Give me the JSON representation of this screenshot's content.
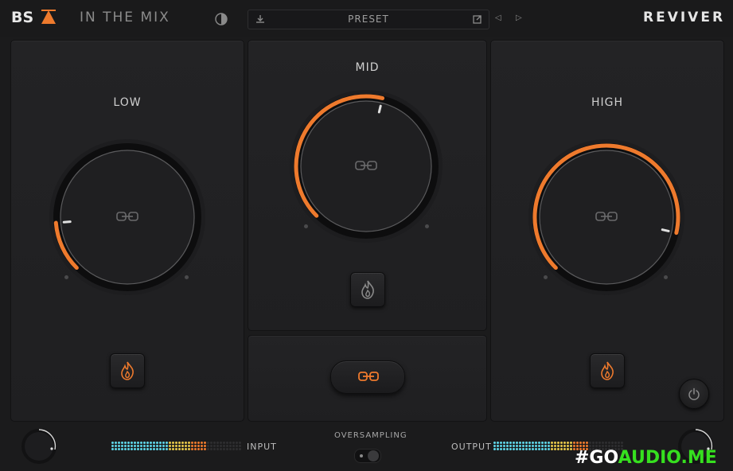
{
  "header": {
    "brand": "BS",
    "plugin_name": "IN THE MIX",
    "preset_label": "PRESET",
    "product_logo": "REVIVER",
    "icons": [
      "contrast-icon",
      "download-icon",
      "save-icon",
      "prev-arrow-icon",
      "next-arrow-icon"
    ]
  },
  "bands": {
    "low": {
      "label": "LOW",
      "level": 0.15
    },
    "mid": {
      "label": "MID",
      "level": 0.55
    },
    "high": {
      "label": "HIGH",
      "level": 0.88
    }
  },
  "meters": {
    "input_label": "INPUT",
    "output_label": "OUTPUT",
    "input_level": 0.72,
    "output_level": 0.72
  },
  "oversampling": {
    "label": "OVERSAMPLING",
    "enabled": false
  },
  "watermark": {
    "part1": "#GO",
    "part2": "AUDIO.ME"
  },
  "colors": {
    "accent": "#ee7a2d",
    "meter_cyan": "#5fd6e8",
    "meter_yellow": "#e8c84a",
    "meter_orange": "#ee7a2d",
    "watermark_green": "#36e01f"
  }
}
